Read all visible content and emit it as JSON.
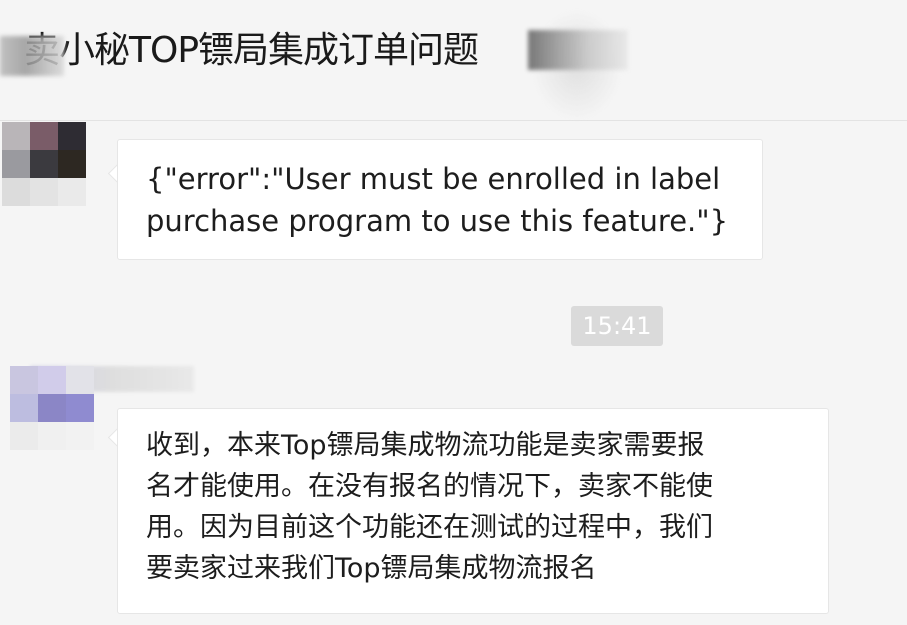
{
  "header": {
    "chat_title": "卖小秘TOP镖局集成订单问题"
  },
  "messages": [
    {
      "text": "{\"error\":\"User must be enrolled in label\npurchase program to use this feature.\"}"
    },
    {
      "timestamp": "15:41"
    },
    {
      "text": "收到，本来Top镖局集成物流功能是卖家需要报\n名才能使用。在没有报名的情况下，卖家不能使\n用。因为目前这个功能还在测试的过程中，我们\n要卖家过来我们Top镖局集成物流报名"
    }
  ],
  "colors": {
    "background": "#f5f5f5",
    "bubble": "#ffffff",
    "timestamp_bg": "#dadada",
    "timestamp_text": "#ffffff",
    "text": "#1d1d1d"
  }
}
